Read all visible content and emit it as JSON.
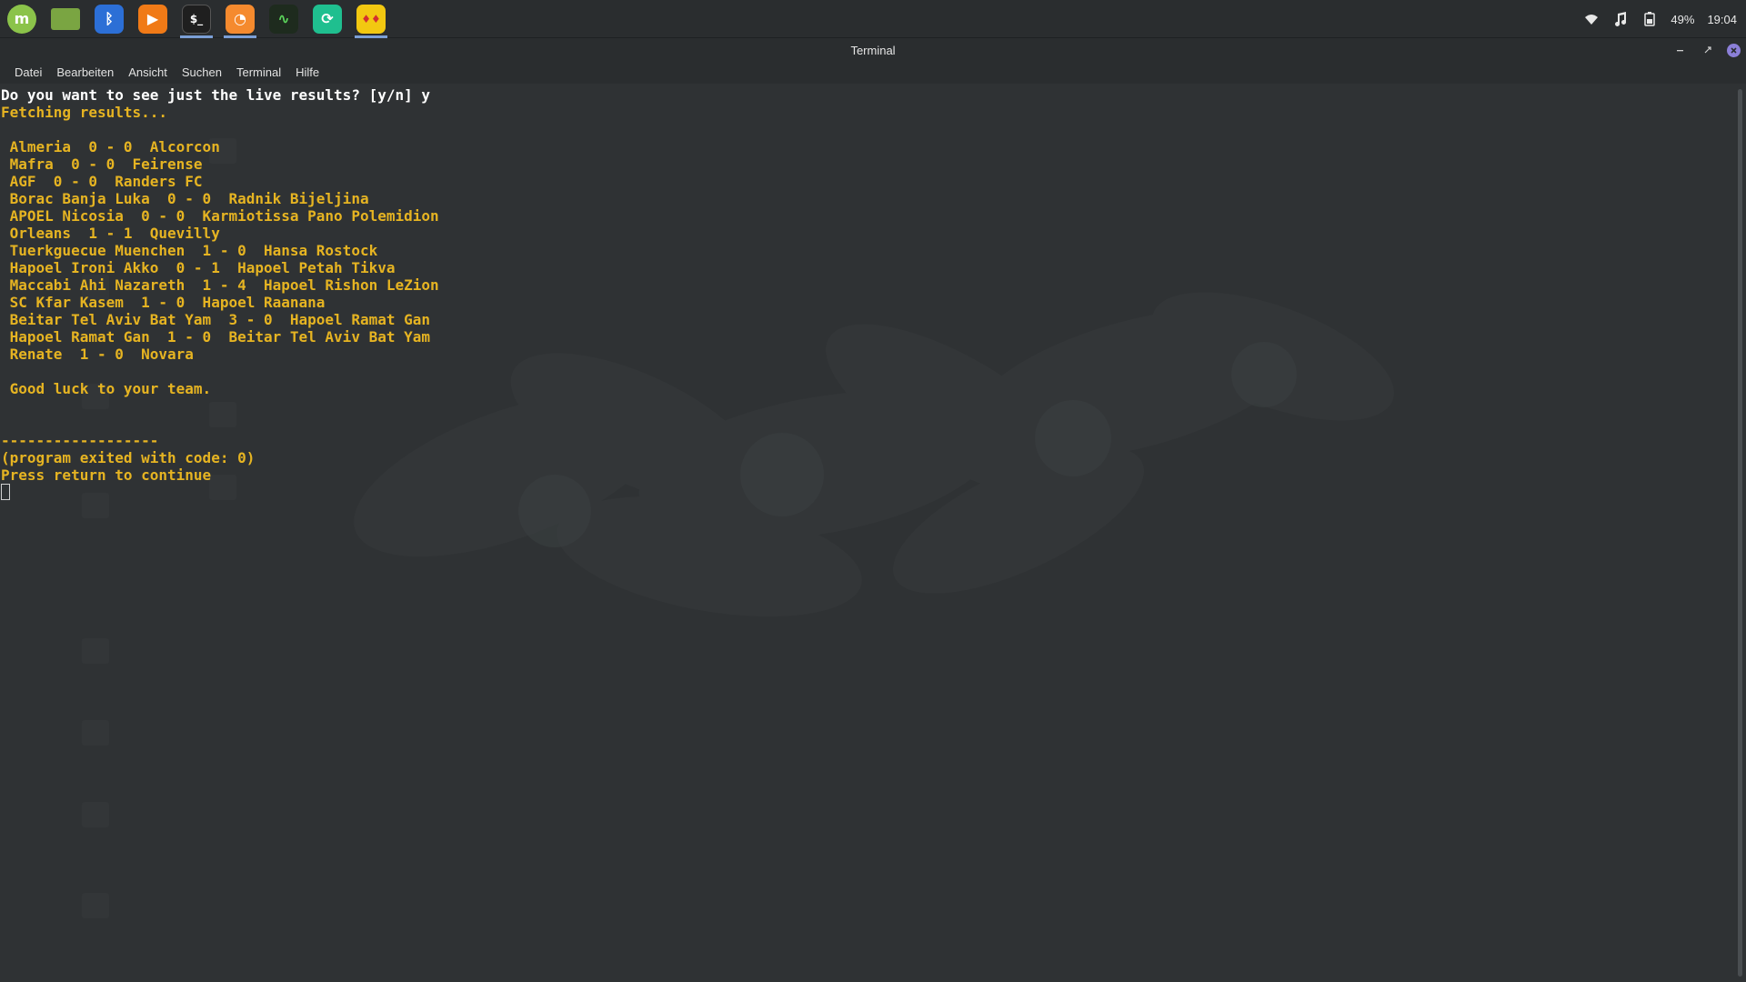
{
  "panel": {
    "launchers": [
      {
        "name": "mint-menu-icon",
        "color": "#8bc34a",
        "glyph": "m",
        "active": false
      },
      {
        "name": "files-icon",
        "color": "#7aa542",
        "glyph": "",
        "active": false
      },
      {
        "name": "bluetooth-icon",
        "color": "#2c6fd6",
        "glyph": "ᛒ",
        "active": false
      },
      {
        "name": "media-player-icon",
        "color": "#f07a17",
        "glyph": "▶",
        "active": false
      },
      {
        "name": "terminal-icon",
        "color": "#1f1f1f",
        "glyph": "$_",
        "active": true
      },
      {
        "name": "firefox-icon",
        "color": "#f58a2e",
        "glyph": "◔",
        "active": true
      },
      {
        "name": "system-monitor-icon",
        "color": "#1e2b1e",
        "glyph": "∿",
        "active": false
      },
      {
        "name": "update-manager-icon",
        "color": "#1fbf8f",
        "glyph": "⟳",
        "active": false
      },
      {
        "name": "app-yellow-icon",
        "color": "#f2c811",
        "glyph": "♦♦",
        "active": true
      }
    ],
    "tray": {
      "battery": "49%",
      "clock": "19:04"
    }
  },
  "window": {
    "title": "Terminal"
  },
  "menu": [
    "Datei",
    "Bearbeiten",
    "Ansicht",
    "Suchen",
    "Terminal",
    "Hilfe"
  ],
  "terminal": {
    "lines": [
      {
        "text": "Do you want to see just the live results? [y/n] y",
        "color": "white"
      },
      {
        "text": "Fetching results...",
        "color": "amber"
      },
      {
        "text": "",
        "color": "amber"
      },
      {
        "text": " Almeria  0 - 0  Alcorcon",
        "color": "amber"
      },
      {
        "text": " Mafra  0 - 0  Feirense",
        "color": "amber"
      },
      {
        "text": " AGF  0 - 0  Randers FC",
        "color": "amber"
      },
      {
        "text": " Borac Banja Luka  0 - 0  Radnik Bijeljina",
        "color": "amber"
      },
      {
        "text": " APOEL Nicosia  0 - 0  Karmiotissa Pano Polemidion",
        "color": "amber"
      },
      {
        "text": " Orleans  1 - 1  Quevilly",
        "color": "amber"
      },
      {
        "text": " Tuerkguecue Muenchen  1 - 0  Hansa Rostock",
        "color": "amber"
      },
      {
        "text": " Hapoel Ironi Akko  0 - 1  Hapoel Petah Tikva",
        "color": "amber"
      },
      {
        "text": " Maccabi Ahi Nazareth  1 - 4  Hapoel Rishon LeZion",
        "color": "amber"
      },
      {
        "text": " SC Kfar Kasem  1 - 0  Hapoel Raanana",
        "color": "amber"
      },
      {
        "text": " Beitar Tel Aviv Bat Yam  3 - 0  Hapoel Ramat Gan",
        "color": "amber"
      },
      {
        "text": " Hapoel Ramat Gan  1 - 0  Beitar Tel Aviv Bat Yam",
        "color": "amber"
      },
      {
        "text": " Renate  1 - 0  Novara",
        "color": "amber"
      },
      {
        "text": "",
        "color": "amber"
      },
      {
        "text": " Good luck to your team.",
        "color": "amber"
      },
      {
        "text": "",
        "color": "amber"
      },
      {
        "text": "",
        "color": "amber"
      },
      {
        "text": "------------------",
        "color": "amber"
      },
      {
        "text": "(program exited with code: 0)",
        "color": "amber"
      },
      {
        "text": "Press return to continue",
        "color": "amber"
      }
    ]
  },
  "colors": {
    "panel_bg": "#2a2d2f",
    "terminal_bg": "#2f3234",
    "terminal_text": "#e6b422",
    "prompt_text": "#ffffff",
    "accent": "#7b9fd6",
    "close_button": "#8b7fd8"
  }
}
